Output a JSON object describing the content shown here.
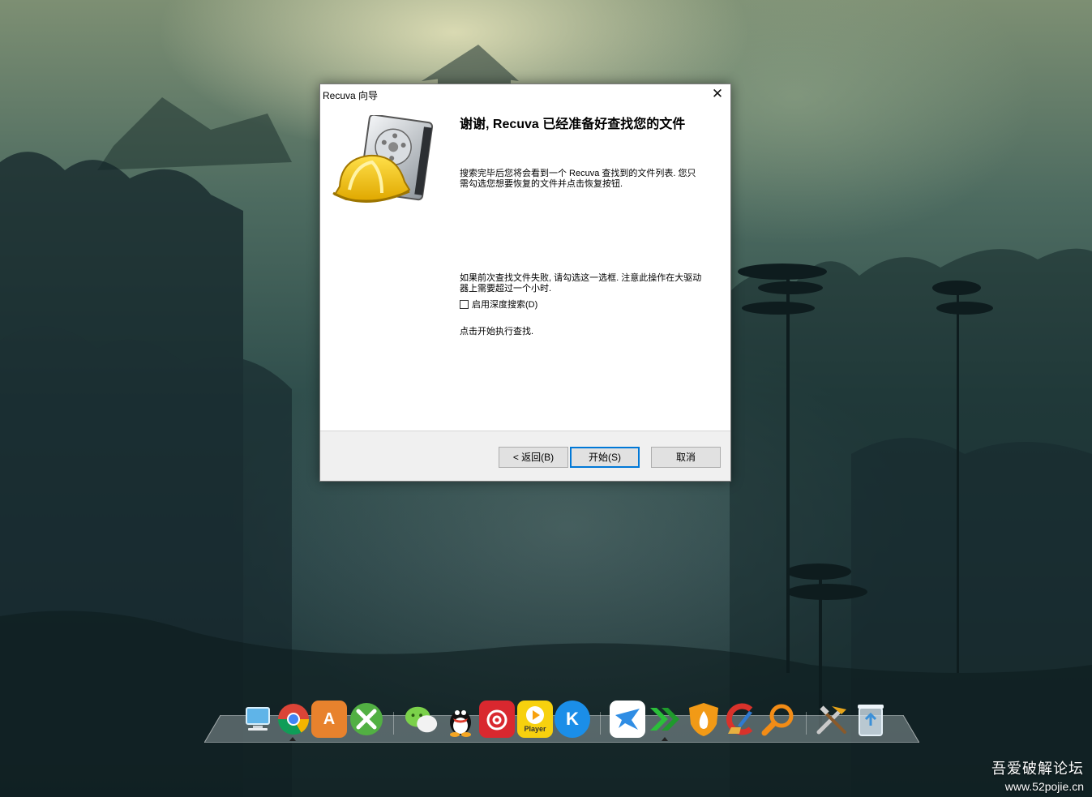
{
  "window": {
    "title": "Recuva 向导",
    "close_glyph": "✕"
  },
  "content": {
    "heading": "谢谢, Recuva 已经准备好查找您的文件",
    "paragraph1": "搜索完毕后您将会看到一个 Recuva 查找到的文件列表. 您只需勾选您想要恢复的文件并点击恢复按钮.",
    "paragraph2": "如果前次查找文件失败, 请勾选这一选框. 注意此操作在大驱动器上需要超过一个小时.",
    "deep_scan_label": "启用深度搜索(D)",
    "deep_scan_checked": false,
    "paragraph3": "点击开始执行查找."
  },
  "buttons": {
    "back": "< 返回(B)",
    "start": "开始(S)",
    "cancel": "取消"
  },
  "dock": {
    "items": [
      {
        "name": "computer-icon",
        "label": ""
      },
      {
        "name": "chrome-icon",
        "label": ""
      },
      {
        "name": "app-store-icon",
        "label": "A"
      },
      {
        "name": "xbox-icon",
        "label": ""
      },
      {
        "name": "wechat-icon",
        "label": ""
      },
      {
        "name": "qq-icon",
        "label": ""
      },
      {
        "name": "netease-music-icon",
        "label": ""
      },
      {
        "name": "player-icon",
        "label": "Player"
      },
      {
        "name": "kugou-icon",
        "label": "K"
      },
      {
        "name": "thunder-icon",
        "label": ""
      },
      {
        "name": "arrow-app-icon",
        "label": ""
      },
      {
        "name": "firewall-icon",
        "label": ""
      },
      {
        "name": "ccleaner-icon",
        "label": ""
      },
      {
        "name": "search-tool-icon",
        "label": ""
      },
      {
        "name": "tools-icon",
        "label": ""
      },
      {
        "name": "recycle-bin-icon",
        "label": ""
      }
    ]
  },
  "watermark": {
    "line1": "吾爱破解论坛",
    "line2": "www.52pojie.cn"
  },
  "colors": {
    "accent": "#0078d7",
    "footer_bg": "#f0f0f0"
  }
}
